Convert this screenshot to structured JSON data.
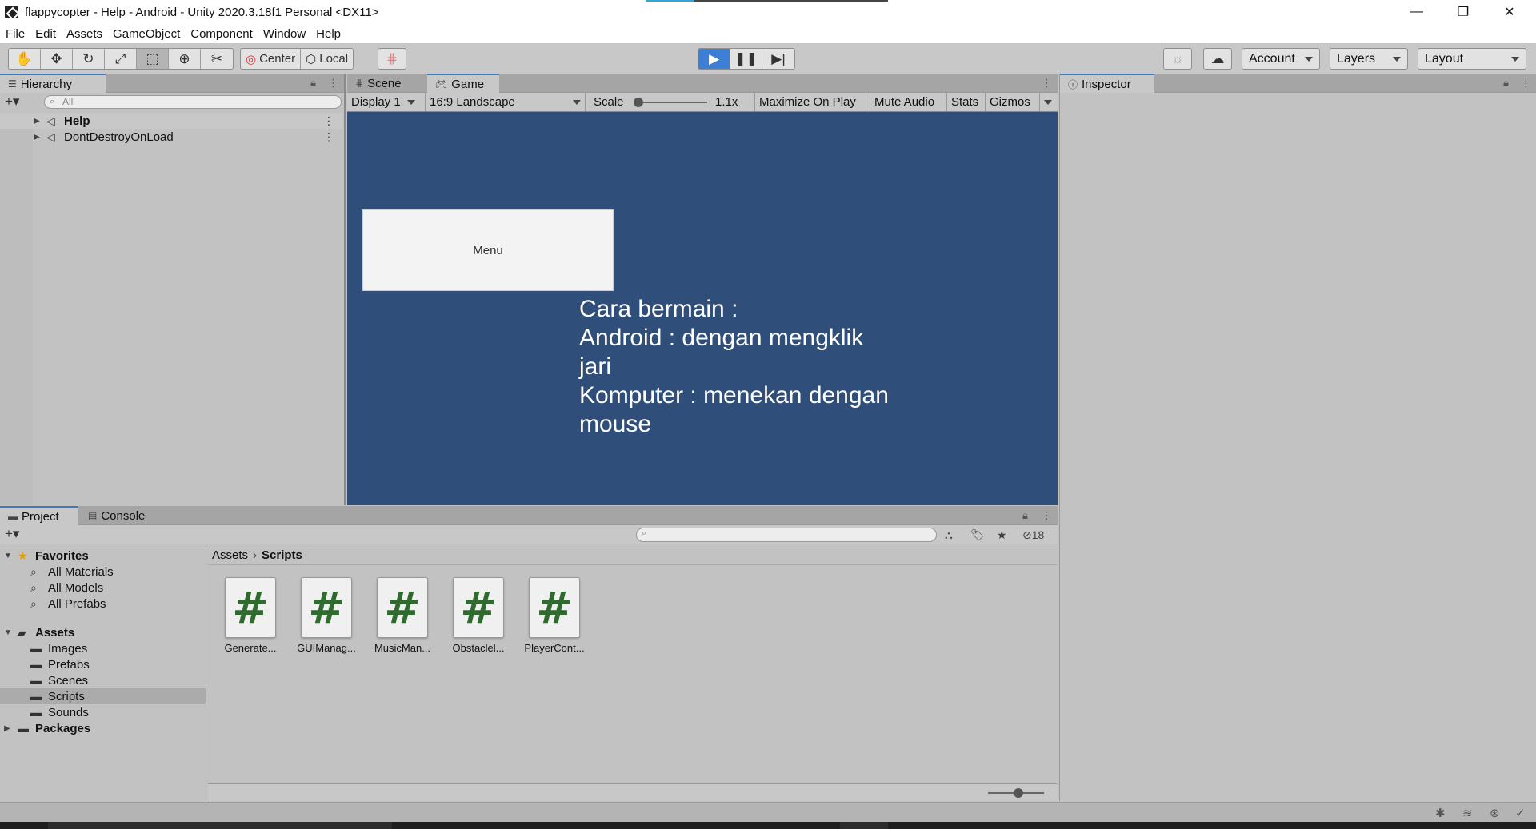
{
  "window": {
    "title": "flappycopter - Help - Android - Unity 2020.3.18f1 Personal <DX11>",
    "minimize": "—",
    "maximize": "❐",
    "close": "✕"
  },
  "menu": [
    "File",
    "Edit",
    "Assets",
    "GameObject",
    "Component",
    "Window",
    "Help"
  ],
  "toolbar": {
    "tools": [
      "hand-tool-icon",
      "move-tool-icon",
      "rotate-tool-icon",
      "scale-tool-icon",
      "rect-tool-icon",
      "transform-tool-icon",
      "custom-tool-icon"
    ],
    "pivot_label": "Center",
    "space_label": "Local",
    "account_label": "Account",
    "layers_label": "Layers",
    "layout_label": "Layout",
    "play_color": "#3d7fd4"
  },
  "hierarchy": {
    "tab": "Hierarchy",
    "search_placeholder": "All",
    "items": [
      {
        "name": "Help",
        "bold": true
      },
      {
        "name": "DontDestroyOnLoad",
        "bold": false
      }
    ]
  },
  "gameview": {
    "tabs": [
      "Scene",
      "Game"
    ],
    "display": "Display 1",
    "aspect": "16:9 Landscape",
    "scale_label": "Scale",
    "scale_value": "1.1x",
    "maximize_on_play": "Maximize On Play",
    "mute_audio": "Mute Audio",
    "stats": "Stats",
    "gizmos": "Gizmos",
    "background_color": "#2f4e7a",
    "menu_button": "Menu",
    "help_text": "Cara bermain :\nAndroid : dengan mengklik\njari\nKomputer : menekan dengan\nmouse"
  },
  "inspector": {
    "tab": "Inspector"
  },
  "project": {
    "tabs": [
      "Project",
      "Console"
    ],
    "hidden_count": "18",
    "favorites": {
      "label": "Favorites",
      "items": [
        "All Materials",
        "All Models",
        "All Prefabs"
      ]
    },
    "assets": {
      "label": "Assets",
      "folders": [
        "Images",
        "Prefabs",
        "Scenes",
        "Scripts",
        "Sounds"
      ],
      "selected": "Scripts"
    },
    "packages_label": "Packages",
    "breadcrumb": [
      "Assets",
      "Scripts"
    ],
    "files": [
      "Generate...",
      "GUIManag...",
      "MusicMan...",
      "Obstaclel...",
      "PlayerCont..."
    ],
    "file_glyph": "#"
  }
}
